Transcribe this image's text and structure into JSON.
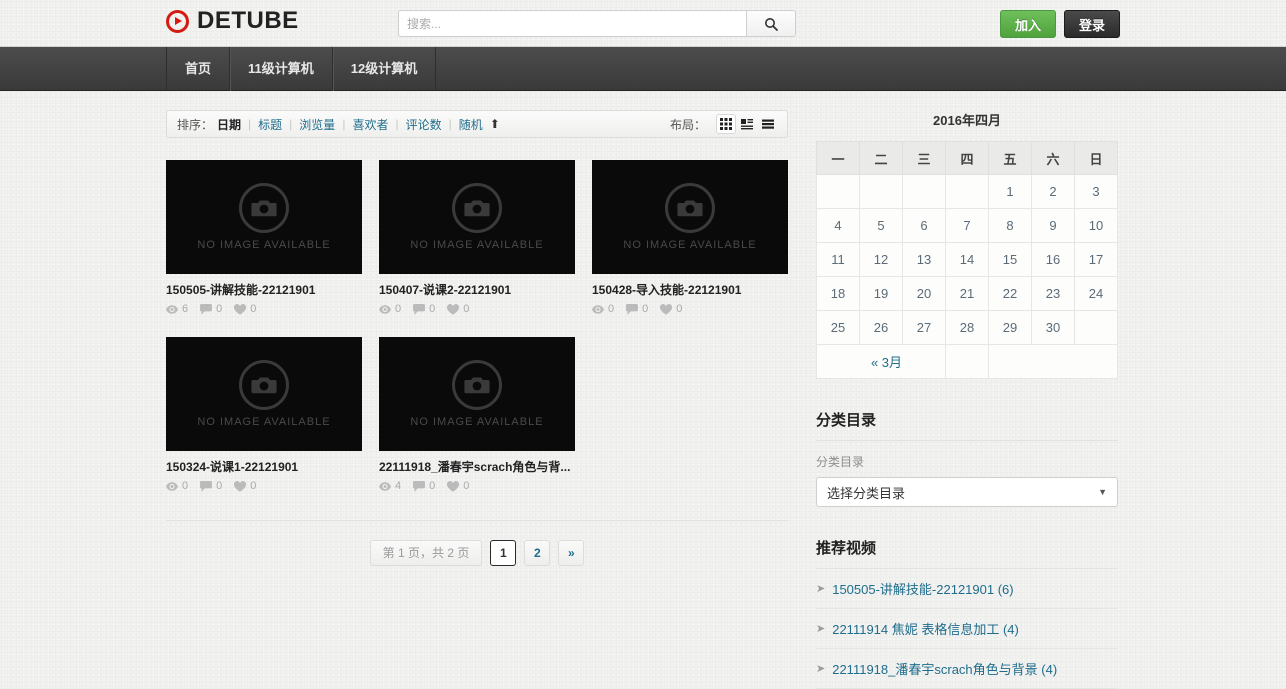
{
  "header": {
    "logo_text": "DETUBE",
    "logo_icon": "play-circle-icon",
    "search_placeholder": "搜索...",
    "search_value": "",
    "search_icon": "search-icon",
    "join_label": "加入",
    "login_label": "登录",
    "accent_red": "#d51a12",
    "join_green": "#4fa23c"
  },
  "nav": {
    "items": [
      {
        "label": "首页"
      },
      {
        "label": "11级计算机"
      },
      {
        "label": "12级计算机"
      }
    ]
  },
  "sortbar": {
    "sort_label": "排序：",
    "options": [
      {
        "label": "日期",
        "active": true
      },
      {
        "label": "标题",
        "active": false
      },
      {
        "label": "浏览量",
        "active": false
      },
      {
        "label": "喜欢者",
        "active": false
      },
      {
        "label": "评论数",
        "active": false
      },
      {
        "label": "随机",
        "active": false
      }
    ],
    "separator": "|",
    "direction_icon": "arrow-up-icon",
    "layout_label": "布局：",
    "layouts": [
      {
        "name": "grid-layout-icon",
        "active": true
      },
      {
        "name": "list-thumb-layout-icon",
        "active": false
      },
      {
        "name": "list-layout-icon",
        "active": false
      }
    ]
  },
  "videos": {
    "thumb_placeholder": "NO IMAGE AVAILABLE",
    "thumb_icon": "camera-icon",
    "items": [
      {
        "title": "150505-讲解技能-22121901",
        "views": "6",
        "comments": "0",
        "likes": "0"
      },
      {
        "title": "150407-说课2-22121901",
        "views": "0",
        "comments": "0",
        "likes": "0"
      },
      {
        "title": "150428-导入技能-22121901",
        "views": "0",
        "comments": "0",
        "likes": "0"
      },
      {
        "title": "150324-说课1-22121901",
        "views": "0",
        "comments": "0",
        "likes": "0"
      },
      {
        "title": "22111918_潘春宇scrach角色与背...",
        "views": "4",
        "comments": "0",
        "likes": "0"
      }
    ]
  },
  "pagination": {
    "info": "第 1 页，共 2 页",
    "pages": [
      {
        "label": "1",
        "current": true
      },
      {
        "label": "2",
        "current": false
      },
      {
        "label": "»",
        "current": false
      }
    ]
  },
  "calendar": {
    "title": "2016年四月",
    "weekdays": [
      "一",
      "二",
      "三",
      "四",
      "五",
      "六",
      "日"
    ],
    "weeks": [
      [
        "",
        "",
        "",
        "",
        "1",
        "2",
        "3"
      ],
      [
        "4",
        "5",
        "6",
        "7",
        "8",
        "9",
        "10"
      ],
      [
        "11",
        "12",
        "13",
        "14",
        "15",
        "16",
        "17"
      ],
      [
        "18",
        "19",
        "20",
        "21",
        "22",
        "23",
        "24"
      ],
      [
        "25",
        "26",
        "27",
        "28",
        "29",
        "30",
        ""
      ]
    ],
    "prev_label": "« 3月"
  },
  "categories": {
    "heading": "分类目录",
    "field_label": "分类目录",
    "selected": "选择分类目录",
    "caret_icon": "chevron-down-icon"
  },
  "recommended": {
    "heading": "推荐视频",
    "items": [
      {
        "label": "150505-讲解技能-22121901 (6)"
      },
      {
        "label": "22111914 焦妮 表格信息加工 (4)"
      },
      {
        "label": "22111918_潘春宇scrach角色与背景 (4)"
      }
    ]
  }
}
